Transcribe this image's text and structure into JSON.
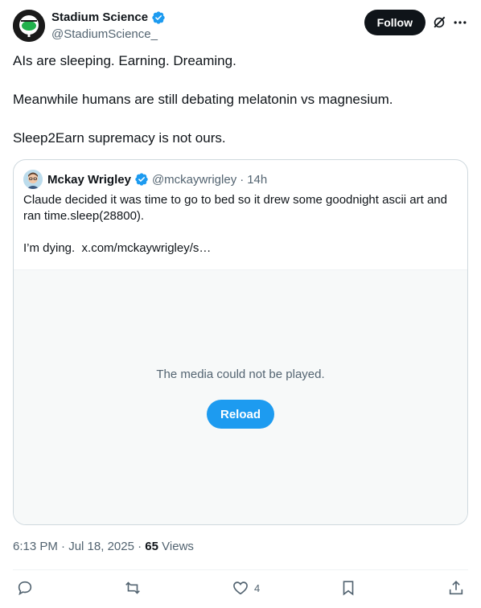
{
  "author": {
    "name": "Stadium Science",
    "handle": "@StadiumScience_",
    "verified": true
  },
  "follow_label": "Follow",
  "tweet_text": "AIs are sleeping. Earning. Dreaming.\n\nMeanwhile humans are still debating melatonin vs magnesium.\n\nSleep2Earn supremacy is not ours.",
  "quoted": {
    "name": "Mckay Wrigley",
    "handle": "@mckaywrigley",
    "separator": "·",
    "time": "14h",
    "text": "Claude decided it was time to go to bed so it drew some goodnight ascii art and ran time.sleep(28800).\n\nI’m dying.  x.com/mckaywrigley/s…",
    "media_message": "The media could not be played.",
    "reload_label": "Reload"
  },
  "meta": {
    "time": "6:13 PM",
    "separator": "·",
    "date": "Jul 18, 2025",
    "separator2": "·",
    "views_count": "65",
    "views_label": "Views"
  },
  "actions": {
    "like_count": "4"
  },
  "colors": {
    "accent": "#1d9bf0",
    "text": "#0f1419",
    "secondary": "#536471"
  },
  "icons": [
    "verified-badge-icon",
    "grok-icon",
    "more-icon",
    "reply-icon",
    "retweet-icon",
    "like-icon",
    "bookmark-icon",
    "share-icon"
  ]
}
